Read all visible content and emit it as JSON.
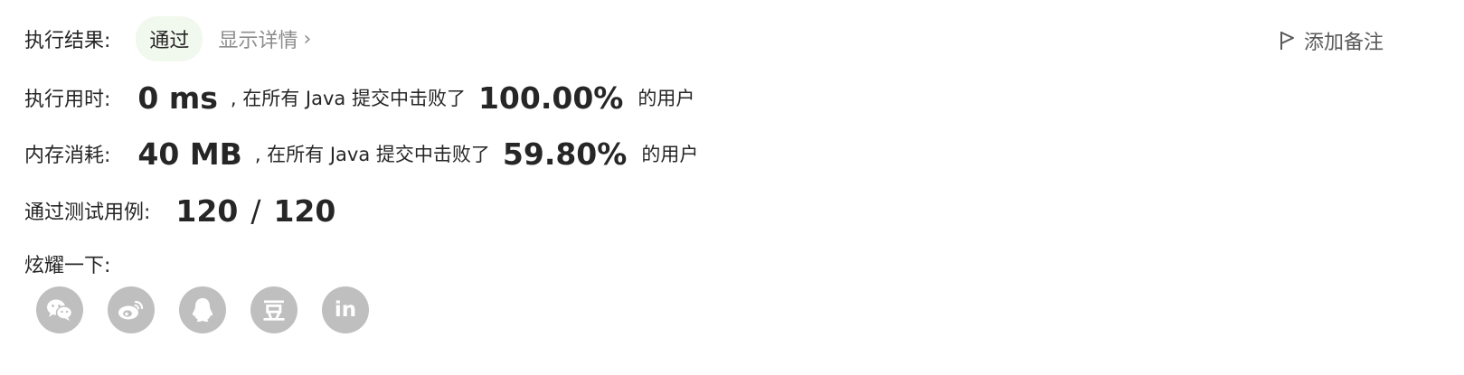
{
  "result": {
    "label": "执行结果:",
    "status": "通过",
    "details_link": "显示详情",
    "details_chevron": "›",
    "add_note": "添加备注"
  },
  "runtime": {
    "label": "执行用时:",
    "value": "0 ms",
    "middle_text": ", 在所有 Java 提交中击败了",
    "percent": "100.00%",
    "suffix": "的用户"
  },
  "memory": {
    "label": "内存消耗:",
    "value": "40 MB",
    "middle_text": ", 在所有 Java 提交中击败了",
    "percent": "59.80%",
    "suffix": "的用户"
  },
  "testcases": {
    "label": "通过测试用例:",
    "passed": "120",
    "separator": "/",
    "total": "120"
  },
  "share": {
    "label": "炫耀一下:",
    "douban_glyph": "豆",
    "linkedin_glyph": "in"
  },
  "colors": {
    "badge_bg": "#f1f8ee",
    "icon_bg": "#bfbfbf",
    "muted_text": "#8c8c8c"
  }
}
